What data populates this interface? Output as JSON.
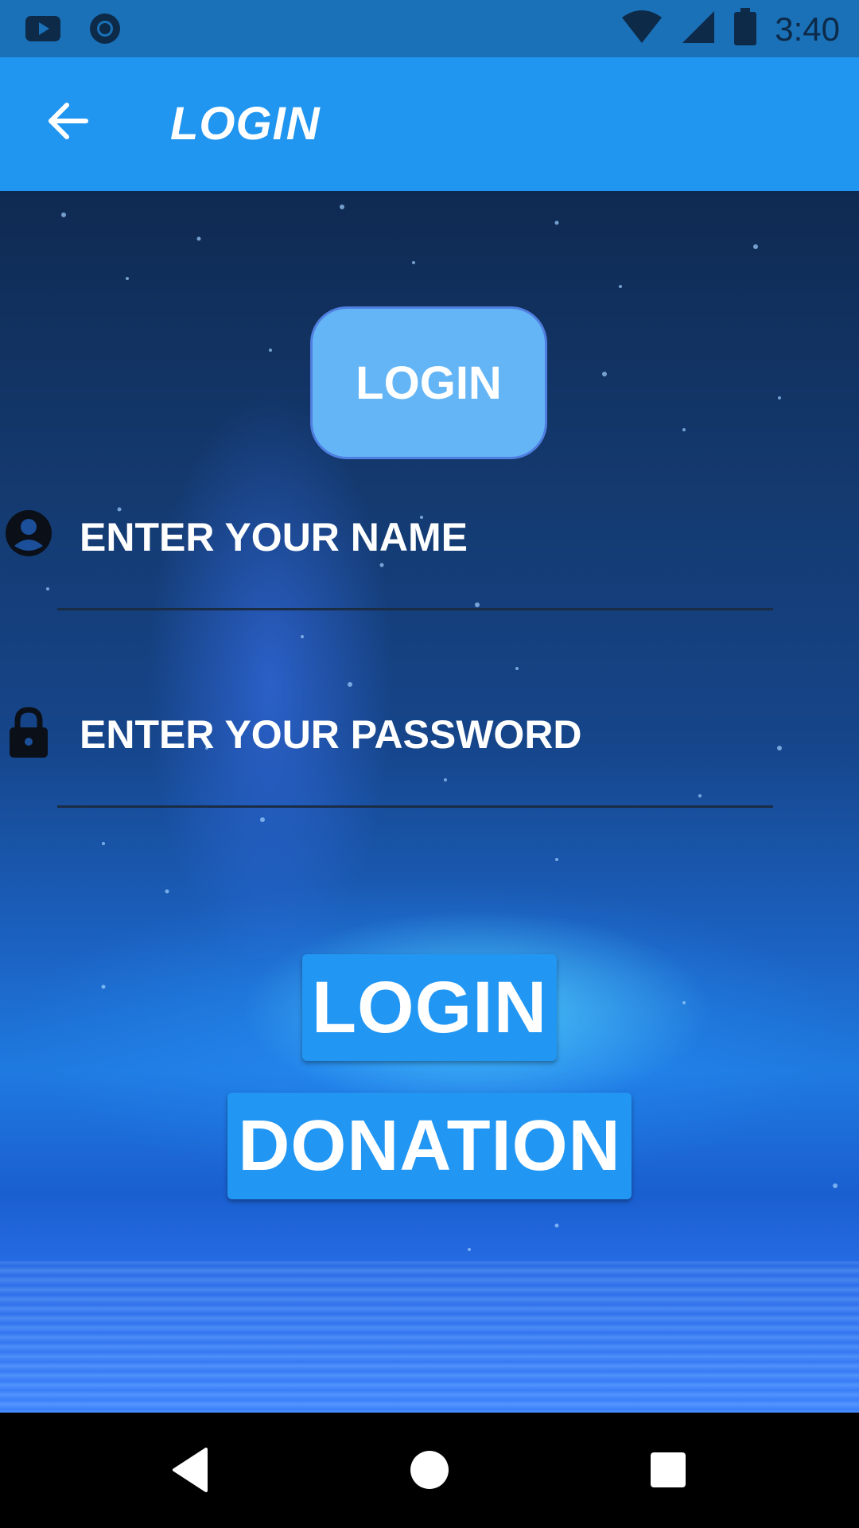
{
  "status_bar": {
    "time": "3:40",
    "icons": [
      "youtube-icon",
      "circle-app-icon",
      "wifi-icon",
      "signal-icon",
      "battery-icon"
    ]
  },
  "app_bar": {
    "title": "LOGIN",
    "back_icon": "arrow-left-icon",
    "color": "#2196f0"
  },
  "header_chip": {
    "label": "LOGIN"
  },
  "form": {
    "name_field": {
      "placeholder": "ENTER YOUR NAME",
      "value": "",
      "icon": "account-circle-icon"
    },
    "password_field": {
      "placeholder": "ENTER YOUR PASSWORD",
      "value": "",
      "icon": "lock-icon"
    }
  },
  "buttons": {
    "login_label": "LOGIN",
    "donation_label": "DONATION",
    "color": "#2196f3"
  },
  "nav_bar": {
    "icons": [
      "back-triangle-icon",
      "home-circle-icon",
      "recents-square-icon"
    ]
  }
}
